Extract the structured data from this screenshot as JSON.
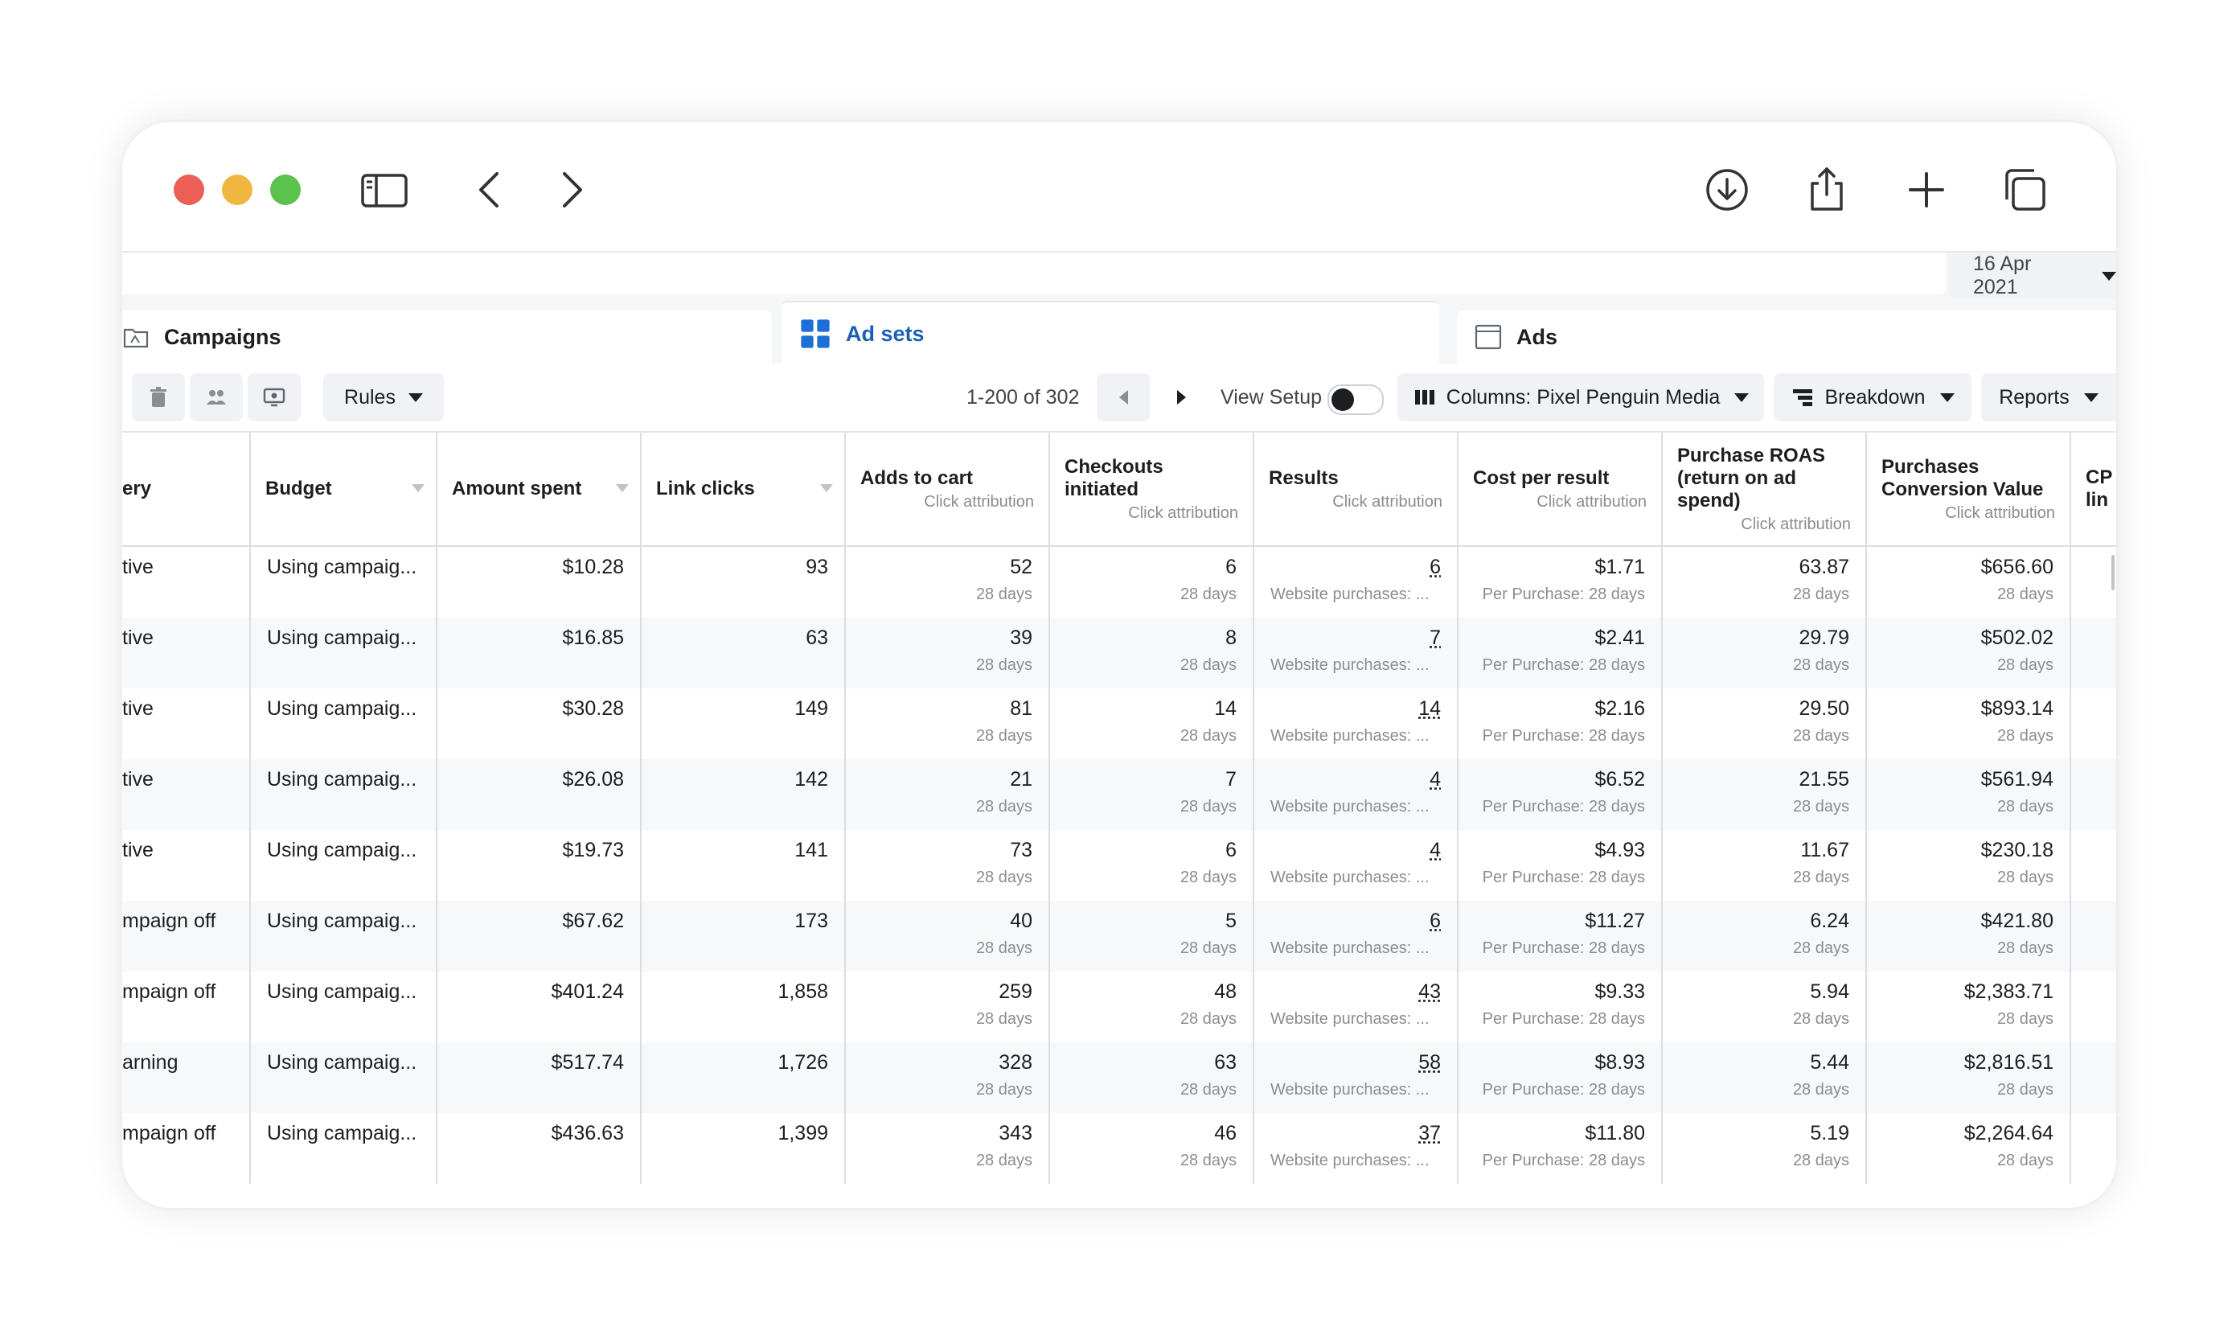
{
  "browser": {
    "controls": {
      "close_color": "#ec5f57",
      "minimize_color": "#f0b740",
      "zoom_color": "#5bc24e"
    },
    "icons": [
      "sidebar-icon",
      "back-icon",
      "forward-icon",
      "download-icon",
      "share-icon",
      "new-tab-icon",
      "tabs-overview-icon"
    ]
  },
  "date_picker": {
    "label": "16 Apr 2021"
  },
  "tabs": {
    "campaigns": "Campaigns",
    "adsets": "Ad sets",
    "ads": "Ads"
  },
  "toolbar": {
    "rules": "Rules",
    "pager": "1-200 of 302",
    "view_setup": "View Setup",
    "columns": "Columns: Pixel Penguin Media",
    "breakdown": "Breakdown",
    "reports": "Reports"
  },
  "table": {
    "headers": [
      {
        "label": "ery",
        "sub": ""
      },
      {
        "label": "Budget",
        "sub": ""
      },
      {
        "label": "Amount spent",
        "sub": ""
      },
      {
        "label": "Link clicks",
        "sub": ""
      },
      {
        "label": "Adds to cart",
        "sub": "Click attribution"
      },
      {
        "label": "Checkouts initiated",
        "sub": "Click attribution"
      },
      {
        "label": "Results",
        "sub": "Click attribution"
      },
      {
        "label": "Cost per result",
        "sub": "Click attribution"
      },
      {
        "label": "Purchase ROAS (return on ad spend)",
        "sub": "Click attribution"
      },
      {
        "label": "Purchases Conversion Value",
        "sub": "Click attribution"
      },
      {
        "label": "CP lin",
        "sub": ""
      }
    ],
    "sub_days": "28 days",
    "sub_results": "Website purchases: ...",
    "sub_cost": "Per Purchase: 28 days",
    "rows": [
      {
        "delivery": "tive",
        "budget": "Using campaig...",
        "spent": "$10.28",
        "clicks": "93",
        "carts": "52",
        "checkouts": "6",
        "results": "6",
        "cost": "$1.71",
        "roas": "63.87",
        "value": "$656.60"
      },
      {
        "delivery": "tive",
        "budget": "Using campaig...",
        "spent": "$16.85",
        "clicks": "63",
        "carts": "39",
        "checkouts": "8",
        "results": "7",
        "cost": "$2.41",
        "roas": "29.79",
        "value": "$502.02"
      },
      {
        "delivery": "tive",
        "budget": "Using campaig...",
        "spent": "$30.28",
        "clicks": "149",
        "carts": "81",
        "checkouts": "14",
        "results": "14",
        "cost": "$2.16",
        "roas": "29.50",
        "value": "$893.14"
      },
      {
        "delivery": "tive",
        "budget": "Using campaig...",
        "spent": "$26.08",
        "clicks": "142",
        "carts": "21",
        "checkouts": "7",
        "results": "4",
        "cost": "$6.52",
        "roas": "21.55",
        "value": "$561.94"
      },
      {
        "delivery": "tive",
        "budget": "Using campaig...",
        "spent": "$19.73",
        "clicks": "141",
        "carts": "73",
        "checkouts": "6",
        "results": "4",
        "cost": "$4.93",
        "roas": "11.67",
        "value": "$230.18"
      },
      {
        "delivery": "mpaign off",
        "budget": "Using campaig...",
        "spent": "$67.62",
        "clicks": "173",
        "carts": "40",
        "checkouts": "5",
        "results": "6",
        "cost": "$11.27",
        "roas": "6.24",
        "value": "$421.80"
      },
      {
        "delivery": "mpaign off",
        "budget": "Using campaig...",
        "spent": "$401.24",
        "clicks": "1,858",
        "carts": "259",
        "checkouts": "48",
        "results": "43",
        "cost": "$9.33",
        "roas": "5.94",
        "value": "$2,383.71"
      },
      {
        "delivery": "arning",
        "budget": "Using campaig...",
        "spent": "$517.74",
        "clicks": "1,726",
        "carts": "328",
        "checkouts": "63",
        "results": "58",
        "cost": "$8.93",
        "roas": "5.44",
        "value": "$2,816.51"
      },
      {
        "delivery": "mpaign off",
        "budget": "Using campaig...",
        "spent": "$436.63",
        "clicks": "1,399",
        "carts": "343",
        "checkouts": "46",
        "results": "37",
        "cost": "$11.80",
        "roas": "5.19",
        "value": "$2,264.64"
      }
    ]
  }
}
